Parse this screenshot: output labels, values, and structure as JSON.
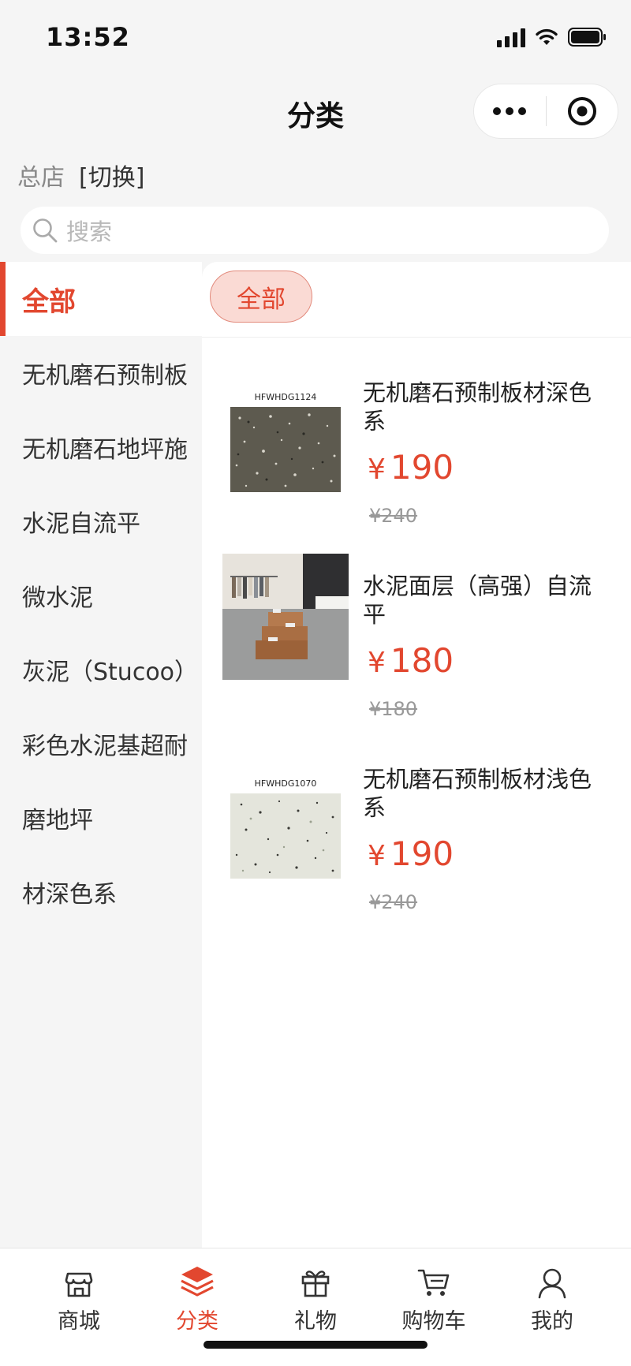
{
  "status_bar": {
    "time": "13:52"
  },
  "nav": {
    "title": "分类"
  },
  "store": {
    "name": "总店",
    "switch_label": "[切换]"
  },
  "search": {
    "placeholder": "搜索"
  },
  "sidebar": {
    "items": [
      {
        "label": "全部",
        "active": true
      },
      {
        "label": "无机磨石预制板"
      },
      {
        "label": "无机磨石地坪施"
      },
      {
        "label": "水泥自流平"
      },
      {
        "label": "微水泥"
      },
      {
        "label": "灰泥（Stucoo）"
      },
      {
        "label": "彩色水泥基超耐"
      },
      {
        "label": "磨地坪"
      },
      {
        "label": "材深色系"
      }
    ]
  },
  "filter": {
    "chip_label": "全部"
  },
  "products": [
    {
      "thumb_label": "HFWHDG1124",
      "name": "无机磨石预制板材深色系",
      "price_symbol": "¥",
      "price": "190",
      "original_price": "¥240",
      "image": "dark-terrazzo"
    },
    {
      "thumb_label": "",
      "name": "水泥面层（高强）自流平",
      "price_symbol": "¥",
      "price": "180",
      "original_price": "¥180",
      "image": "store-interior"
    },
    {
      "thumb_label": "HFWHDG1070",
      "name": "无机磨石预制板材浅色系",
      "price_symbol": "¥",
      "price": "190",
      "original_price": "¥240",
      "image": "light-terrazzo"
    }
  ],
  "tabbar": {
    "items": [
      {
        "label": "商城",
        "icon": "shop-icon"
      },
      {
        "label": "分类",
        "icon": "layers-icon",
        "active": true
      },
      {
        "label": "礼物",
        "icon": "gift-icon"
      },
      {
        "label": "购物车",
        "icon": "cart-icon"
      },
      {
        "label": "我的",
        "icon": "user-icon"
      }
    ]
  },
  "colors": {
    "accent": "#e2472f",
    "chip_bg": "#fadad4",
    "background": "#f5f5f5"
  }
}
